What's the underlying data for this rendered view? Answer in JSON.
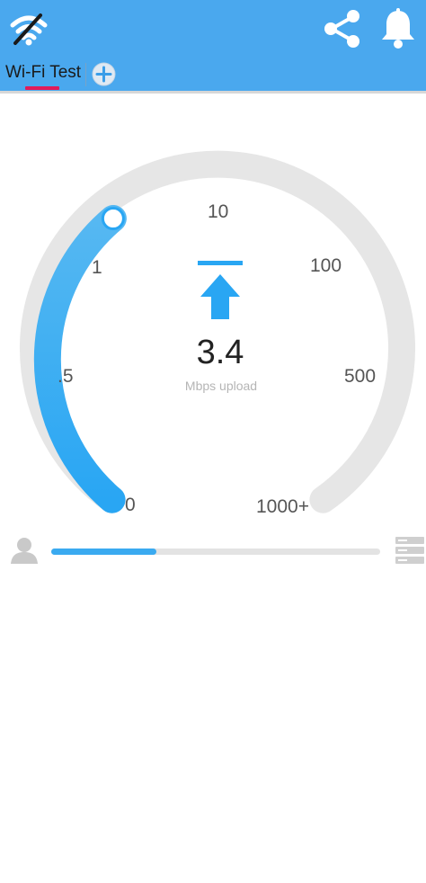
{
  "header": {
    "logo_icon": "wifi-signal-icon",
    "share_icon": "share-icon",
    "bell_icon": "bell-icon"
  },
  "tabs": {
    "items": [
      {
        "label": "Wi-Fi Test",
        "active": true
      }
    ],
    "add_icon": "plus-circle-icon"
  },
  "gauge": {
    "ticks": [
      "0",
      ".5",
      "1",
      "10",
      "100",
      "500",
      "1000+"
    ],
    "value": "3.4",
    "unit": "Mbps upload",
    "direction_icon": "upload-arrow-icon",
    "fill_fraction": 0.3
  },
  "progress": {
    "left_icon": "user-icon",
    "right_icon": "server-icon",
    "fraction": 0.32
  },
  "colors": {
    "header_bg": "#4aa8ee",
    "accent": "#3aaaf0",
    "tab_indicator": "#e21b5a",
    "gauge_track": "#e6e6e6"
  }
}
